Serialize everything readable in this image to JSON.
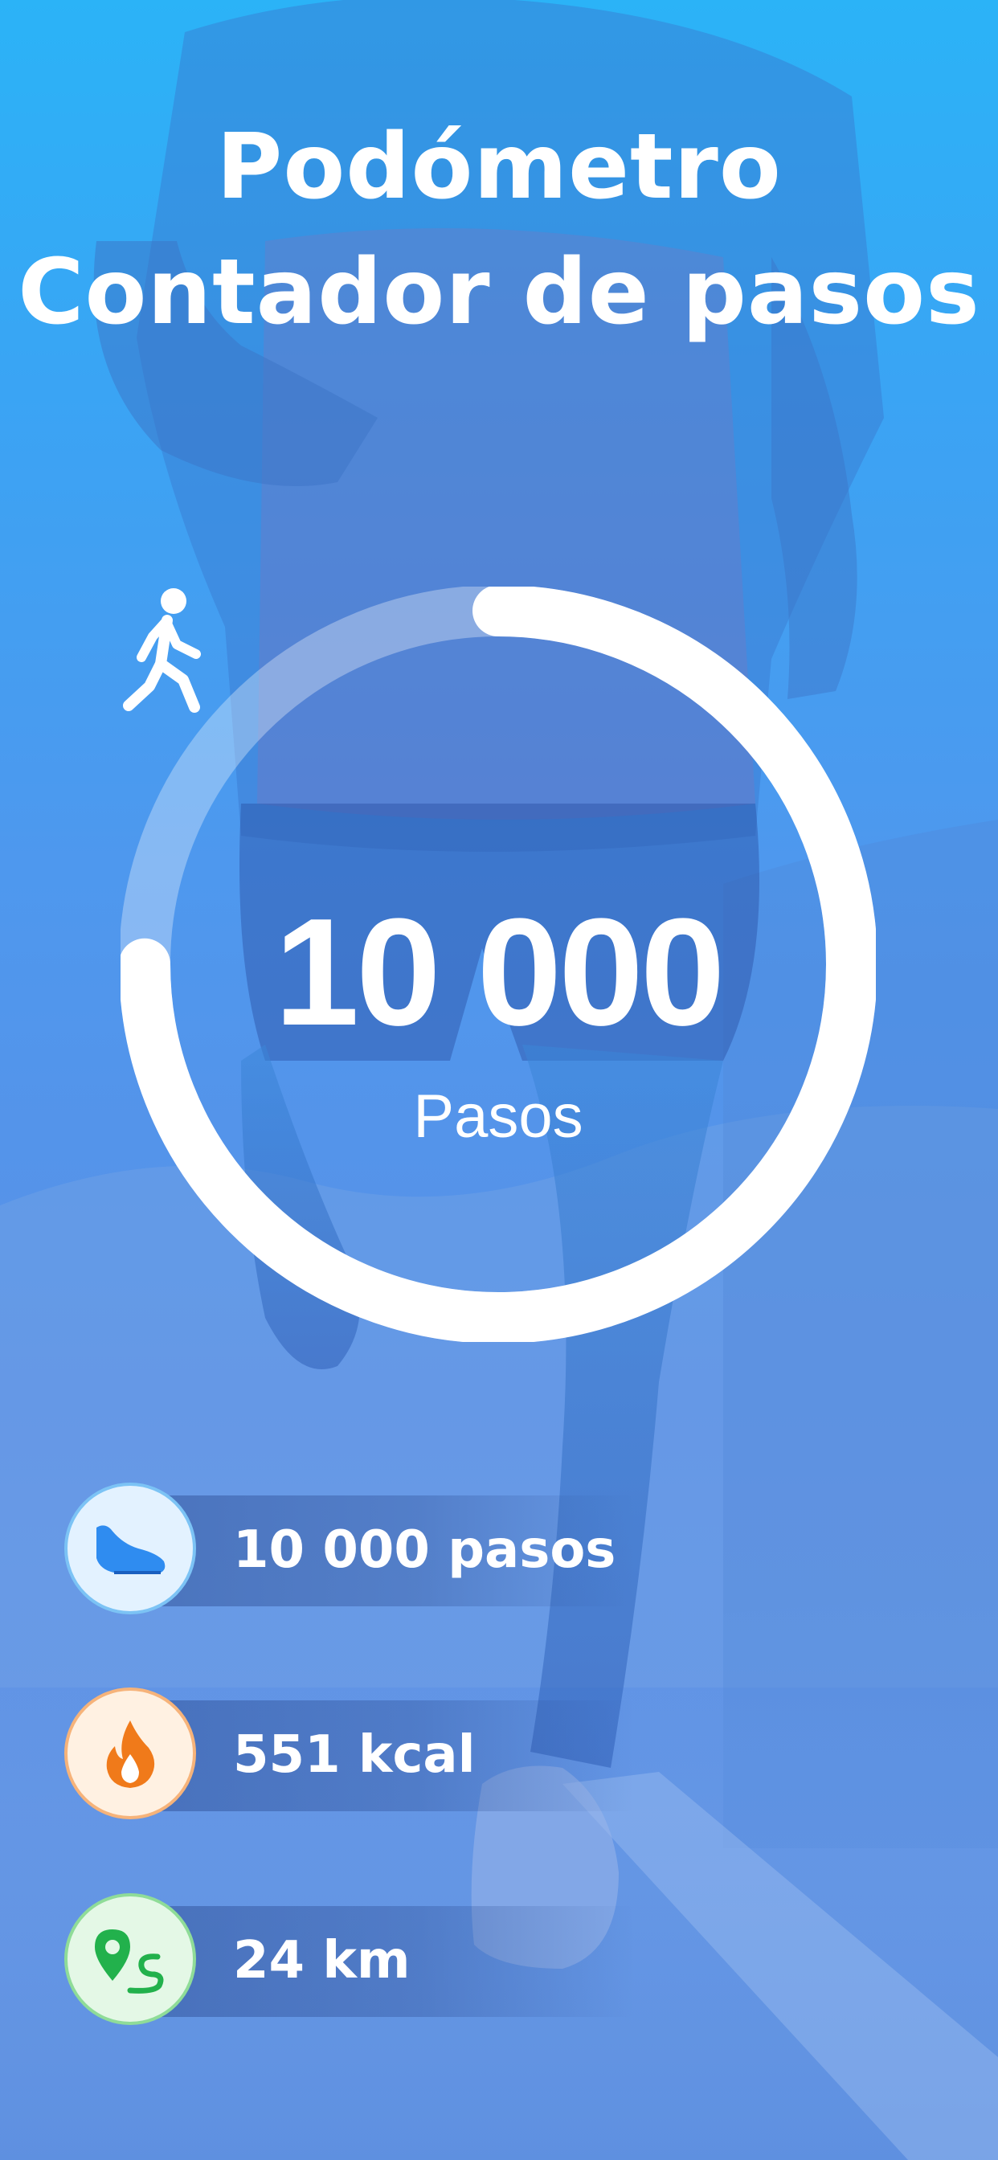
{
  "header": {
    "line1": "Podómetro",
    "line2": "Contador de pasos"
  },
  "progress": {
    "value_text": "10 000",
    "label": "Pasos",
    "fraction": 0.75,
    "icon": "walking-person-icon"
  },
  "stats": [
    {
      "icon": "sneaker-icon",
      "text": "10 000 pasos",
      "color": "#2f8cf0"
    },
    {
      "icon": "flame-icon",
      "text": "551 kcal",
      "color": "#f07a1a"
    },
    {
      "icon": "route-pin-icon",
      "text": "24 km",
      "color": "#22b14c"
    }
  ],
  "colors": {
    "sky_top": "#2bb3f7",
    "sky_bottom": "#6a98e4",
    "ring": "#ffffff"
  }
}
